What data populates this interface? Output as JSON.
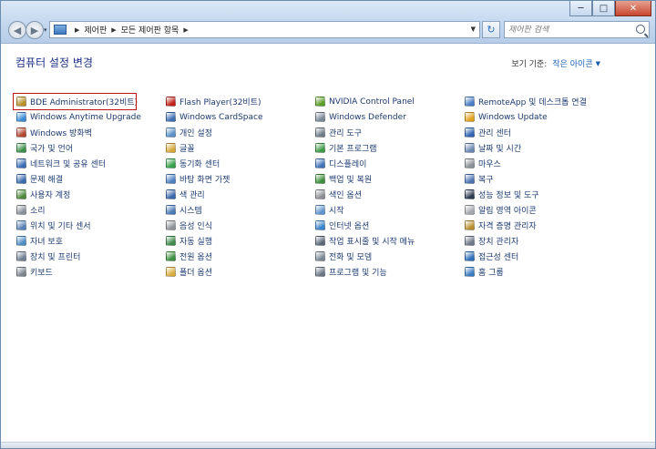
{
  "window": {
    "controls": {
      "minimize": "─",
      "maximize": "□",
      "close": "✕"
    }
  },
  "nav": {
    "back_glyph": "◀",
    "forward_glyph": "▶",
    "history_drop": "▾",
    "refresh_glyph": "↻"
  },
  "breadcrumb": {
    "items": [
      "제어판",
      "모든 제어판 항목"
    ],
    "sep": "▶",
    "drop": "▼"
  },
  "search": {
    "placeholder": "제어판 검색"
  },
  "header": {
    "title": "컴퓨터 설정 변경",
    "view_by_label": "보기 기준:",
    "view_by_value": "작은 아이콘",
    "view_by_arrow": "▼"
  },
  "items": [
    {
      "label": "BDE Administrator(32비트)",
      "icon": "bde-admin-icon",
      "color": "#b8902a",
      "highlight": true
    },
    {
      "label": "Flash Player(32비트)",
      "icon": "flash-player-icon",
      "color": "#c2221a"
    },
    {
      "label": "NVIDIA Control Panel",
      "icon": "nvidia-icon",
      "color": "#5c9e2a"
    },
    {
      "label": "RemoteApp 및 데스크톱 연결",
      "icon": "remoteapp-icon",
      "color": "#4a7ec4"
    },
    {
      "label": "Windows Anytime Upgrade",
      "icon": "anytime-upgrade-icon",
      "color": "#3b8bd6"
    },
    {
      "label": "Windows CardSpace",
      "icon": "cardspace-icon",
      "color": "#3d6fb3"
    },
    {
      "label": "Windows Defender",
      "icon": "defender-icon",
      "color": "#7a8795"
    },
    {
      "label": "Windows Update",
      "icon": "windows-update-icon",
      "color": "#e0a21e"
    },
    {
      "label": "Windows 방화벽",
      "icon": "firewall-icon",
      "color": "#b3462e"
    },
    {
      "label": "개인 설정",
      "icon": "personalization-icon",
      "color": "#5a8fc8"
    },
    {
      "label": "관리 도구",
      "icon": "admin-tools-icon",
      "color": "#6f7c8a"
    },
    {
      "label": "관리 센터",
      "icon": "action-center-icon",
      "color": "#2f64b0"
    },
    {
      "label": "국가 및 언어",
      "icon": "region-language-icon",
      "color": "#3c8f4a"
    },
    {
      "label": "글꼴",
      "icon": "fonts-icon",
      "color": "#d6a93a"
    },
    {
      "label": "기본 프로그램",
      "icon": "default-programs-icon",
      "color": "#3e9a43"
    },
    {
      "label": "날짜 및 시간",
      "icon": "date-time-icon",
      "color": "#6a88b0"
    },
    {
      "label": "네트워크 및 공유 센터",
      "icon": "network-sharing-icon",
      "color": "#3a6fb6"
    },
    {
      "label": "동기화 센터",
      "icon": "sync-center-icon",
      "color": "#37a04a"
    },
    {
      "label": "디스플레이",
      "icon": "display-icon",
      "color": "#3f73b8"
    },
    {
      "label": "마우스",
      "icon": "mouse-icon",
      "color": "#8b8f96"
    },
    {
      "label": "문제 해결",
      "icon": "troubleshooting-icon",
      "color": "#3a6cae"
    },
    {
      "label": "바탕 화면 가젯",
      "icon": "desktop-gadgets-icon",
      "color": "#4d80c0"
    },
    {
      "label": "백업 및 복원",
      "icon": "backup-restore-icon",
      "color": "#3e8f3c"
    },
    {
      "label": "복구",
      "icon": "recovery-icon",
      "color": "#4b74b0"
    },
    {
      "label": "사용자 계정",
      "icon": "user-accounts-icon",
      "color": "#4f8a3c"
    },
    {
      "label": "색 관리",
      "icon": "color-management-icon",
      "color": "#3a67aa"
    },
    {
      "label": "색인 옵션",
      "icon": "indexing-options-icon",
      "color": "#8c8f95"
    },
    {
      "label": "성능 정보 및 도구",
      "icon": "performance-icon",
      "color": "#2c3b52"
    },
    {
      "label": "소리",
      "icon": "sound-icon",
      "color": "#8a9099"
    },
    {
      "label": "시스템",
      "icon": "system-icon",
      "color": "#4a79b6"
    },
    {
      "label": "시작",
      "icon": "getting-started-icon",
      "color": "#5f95cf"
    },
    {
      "label": "알림 영역 아이콘",
      "icon": "notification-icons-icon",
      "color": "#a4a8ae"
    },
    {
      "label": "위치 및 기타 센서",
      "icon": "location-sensors-icon",
      "color": "#5a83b5"
    },
    {
      "label": "음성 인식",
      "icon": "speech-recognition-icon",
      "color": "#8f9399"
    },
    {
      "label": "인터넷 옵션",
      "icon": "internet-options-icon",
      "color": "#3b84c9"
    },
    {
      "label": "자격 증명 관리자",
      "icon": "credential-manager-icon",
      "color": "#b9902f"
    },
    {
      "label": "자녀 보호",
      "icon": "parental-controls-icon",
      "color": "#4e8cc4"
    },
    {
      "label": "자동 실행",
      "icon": "autoplay-icon",
      "color": "#3d8a4b"
    },
    {
      "label": "작업 표시줄 및 시작 메뉴",
      "icon": "taskbar-start-icon",
      "color": "#5b6778"
    },
    {
      "label": "장치 관리자",
      "icon": "device-manager-icon",
      "color": "#6d7888"
    },
    {
      "label": "장치 및 프린터",
      "icon": "devices-printers-icon",
      "color": "#6f7f92"
    },
    {
      "label": "전원 옵션",
      "icon": "power-options-icon",
      "color": "#3c8f3f"
    },
    {
      "label": "전화 및 모뎀",
      "icon": "phone-modem-icon",
      "color": "#7b8794"
    },
    {
      "label": "접근성 센터",
      "icon": "ease-of-access-icon",
      "color": "#2f6fb8"
    },
    {
      "label": "키보드",
      "icon": "keyboard-icon",
      "color": "#7d848d"
    },
    {
      "label": "폴더 옵션",
      "icon": "folder-options-icon",
      "color": "#d8ae3e"
    },
    {
      "label": "프로그램 및 기능",
      "icon": "programs-features-icon",
      "color": "#6b7685"
    },
    {
      "label": "홈 그룹",
      "icon": "homegroup-icon",
      "color": "#3a7bc1"
    }
  ]
}
